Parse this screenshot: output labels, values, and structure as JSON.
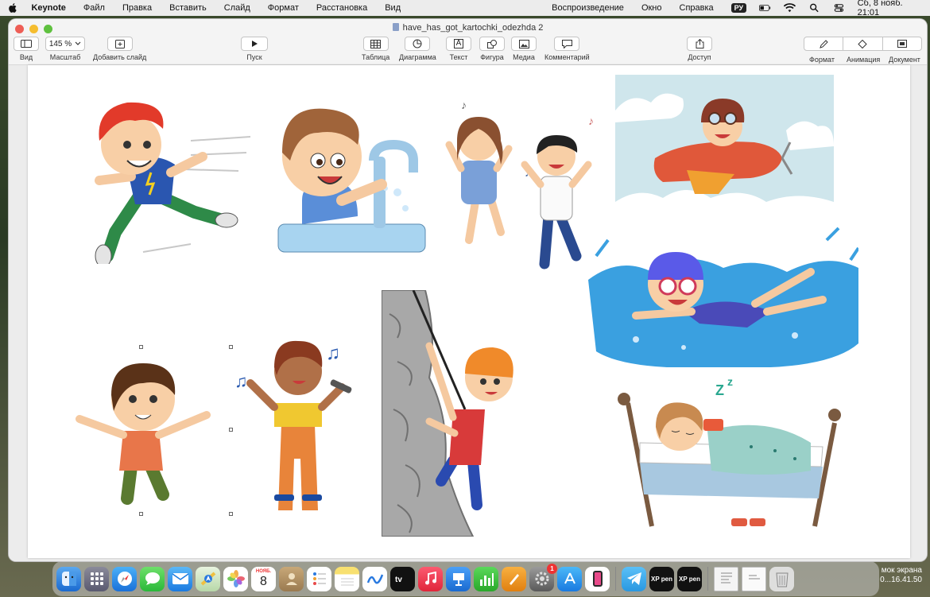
{
  "menubar": {
    "app": "Keynote",
    "items": [
      "Файл",
      "Правка",
      "Вставить",
      "Слайд",
      "Формат",
      "Расстановка",
      "Вид",
      "Воспроизведение",
      "Окно",
      "Справка"
    ],
    "lang": "РУ",
    "datetime": "Сб, 8 нояб.  21:01"
  },
  "window": {
    "title": "have_has_got_kartochki_odezhda 2"
  },
  "toolbar": {
    "view": "Вид",
    "zoom_value": "145 %",
    "zoom": "Масштаб",
    "add_slide": "Добавить слайд",
    "play": "Пуск",
    "table": "Таблица",
    "chart": "Диаграмма",
    "text": "Текст",
    "shape": "Фигура",
    "media": "Медиа",
    "comment": "Комментарий",
    "share": "Доступ",
    "format": "Формат",
    "animate": "Анимация",
    "document": "Документ",
    "text_icon_glyph": "A"
  },
  "dock": {
    "calendar_month": "НОЯБ.",
    "calendar_day": "8",
    "xp_label_1": "XP pen",
    "xp_label_2": "XP pen",
    "badge": "1"
  },
  "screenshot_label": {
    "line1": "мок экрана",
    "line2": "0...16.41.50"
  },
  "colors": {
    "menubar_bg": "#ececec",
    "window_bg": "#f4f4f4",
    "slide_bg": "#ffffff",
    "accent_blue": "#2a7fd8"
  }
}
